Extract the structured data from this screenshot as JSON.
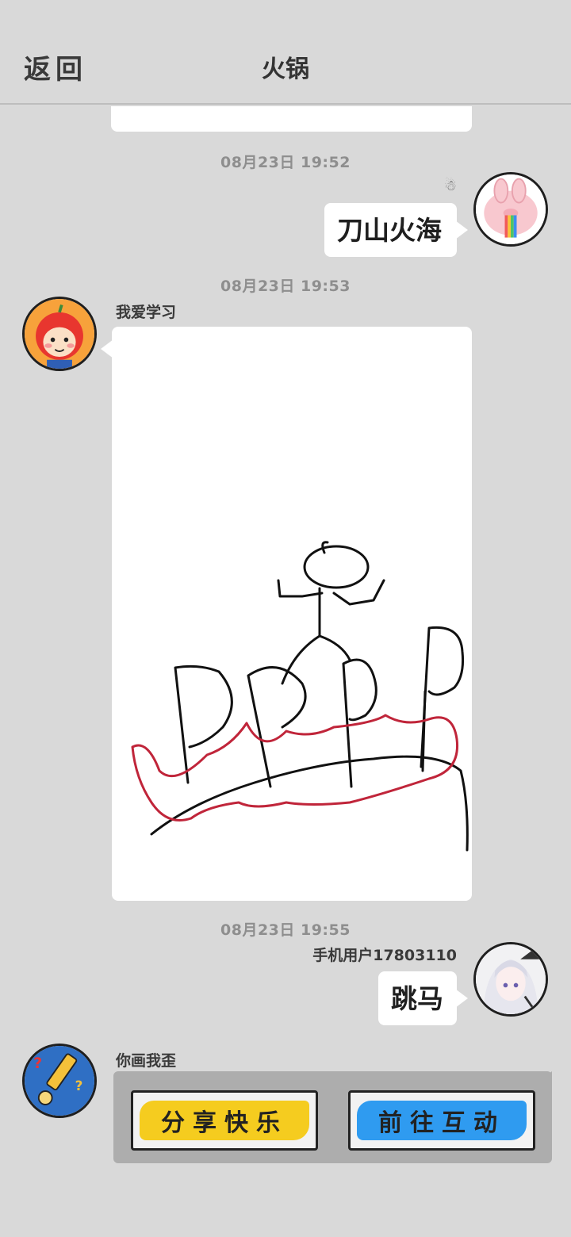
{
  "header": {
    "back_label": "返回",
    "title": "火锅"
  },
  "messages": [
    {
      "timestamp": "08月23日  19:52",
      "side": "right",
      "avatar": "pink-rabbit-rainbow-avatar",
      "text": "刀山火海",
      "status_icon": "person-outline-icon"
    },
    {
      "timestamp": "08月23日  19:53",
      "side": "left",
      "avatar": "apple-kid-avatar",
      "sender": "我爱学习",
      "type": "drawing"
    },
    {
      "timestamp": "08月23日  19:55",
      "side": "right",
      "avatar": "white-hair-anime-girl-avatar",
      "sender": "手机用户17803110",
      "text": "跳马"
    },
    {
      "side": "left",
      "avatar": "pencil-game-avatar",
      "sender": "你画我歪",
      "type": "game-card",
      "buttons": [
        {
          "label": "分享快乐",
          "color": "#f5cc1f"
        },
        {
          "label": "前往互动",
          "color": "#2f9bf0"
        }
      ]
    }
  ],
  "colors": {
    "background": "#d9d9d9",
    "bubble": "#ffffff",
    "timestamp": "#8e8e8e",
    "card": "#adadad",
    "drawing_stroke": "#111111",
    "drawing_red": "#c0253a"
  }
}
